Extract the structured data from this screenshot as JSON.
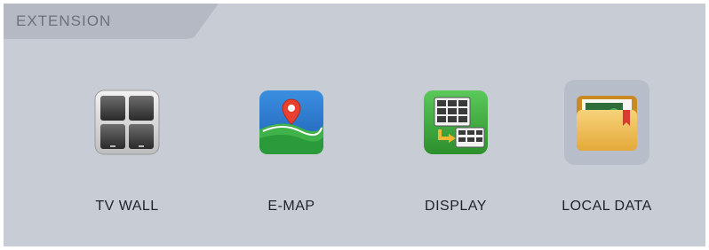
{
  "header": {
    "title": "EXTENSION"
  },
  "items": [
    {
      "label": "TV WALL",
      "icon": "tv-wall-icon"
    },
    {
      "label": "E-MAP",
      "icon": "e-map-icon"
    },
    {
      "label": "DISPLAY",
      "icon": "display-icon"
    },
    {
      "label": "LOCAL DATA",
      "icon": "local-data-icon",
      "selected": true
    }
  ],
  "colors": {
    "panel": "#c8ccd4",
    "header_tab": "#b4b9c3",
    "selected_bg": "#b8bec9",
    "label_text": "#1f2328"
  }
}
